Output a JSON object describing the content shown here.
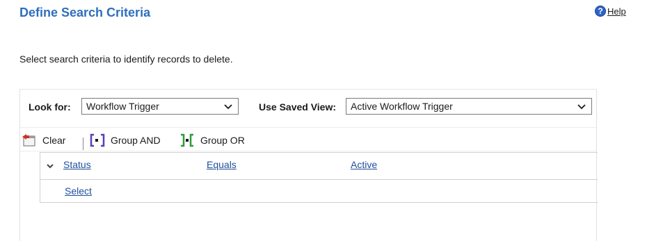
{
  "header": {
    "title": "Define Search Criteria",
    "help_label": "Help",
    "help_icon": "question-circle-icon"
  },
  "instructions": "Select search criteria to identify records to delete.",
  "criteria": {
    "look_for_label": "Look for:",
    "look_for_value": "Workflow Trigger",
    "saved_view_label": "Use Saved View:",
    "saved_view_value": "Active Workflow Trigger"
  },
  "toolbar": {
    "clear_label": "Clear",
    "group_and_label": "Group AND",
    "group_or_label": "Group OR"
  },
  "conditions": {
    "rows": [
      {
        "field": "Status",
        "operator": "Equals",
        "value": "Active"
      }
    ],
    "select_label": "Select"
  },
  "colors": {
    "title": "#2e6fbd",
    "link": "#1f4e9c",
    "group_and_icon": "#5a3fb5",
    "group_or_icon": "#2e9b3a",
    "clear_icon_arrow": "#d0302a"
  }
}
